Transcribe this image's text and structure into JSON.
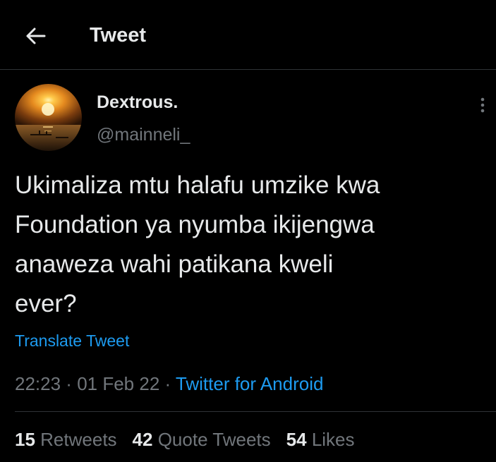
{
  "header": {
    "title": "Tweet",
    "back_icon": "arrow-left-icon"
  },
  "tweet": {
    "display_name": "Dextrous.",
    "handle": "@mainneli_",
    "text_lines": [
      "Ukimaliza mtu halafu umzike kwa",
      "Foundation ya nyumba ikijengwa",
      "anaweza wahi patikana kweli",
      "ever?"
    ],
    "translate_label": "Translate Tweet",
    "time": "22:23",
    "date": "01 Feb 22",
    "separator": " · ",
    "source": "Twitter for Android",
    "more_icon": "more-vertical-icon"
  },
  "stats": {
    "retweets_count": "15",
    "retweets_label": "Retweets",
    "quotes_count": "42",
    "quotes_label": "Quote Tweets",
    "likes_count": "54",
    "likes_label": "Likes"
  },
  "colors": {
    "background": "#000000",
    "text": "#e7e9ea",
    "muted": "#71767b",
    "accent": "#1d9bf0",
    "divider": "#2f3336"
  }
}
